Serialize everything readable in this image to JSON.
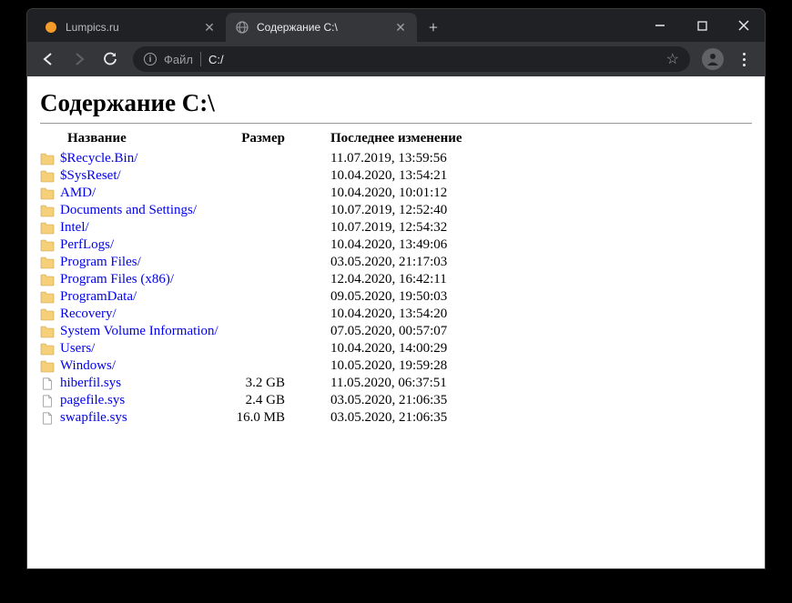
{
  "window": {
    "controls": {
      "minimize": "—",
      "maximize": "▢",
      "close": "✕"
    }
  },
  "tabs": [
    {
      "title": "Lumpics.ru",
      "active": false,
      "favicon": "orange-circle"
    },
    {
      "title": "Содержание C:\\",
      "active": true,
      "favicon": "globe"
    }
  ],
  "toolbar": {
    "address_label": "Файл",
    "address_path": "C:/",
    "newtab": "+"
  },
  "page": {
    "heading": "Содержание C:\\",
    "columns": {
      "name": "Название",
      "size": "Размер",
      "modified": "Последнее изменение"
    },
    "entries": [
      {
        "type": "dir",
        "name": "$Recycle.Bin/",
        "size": "",
        "modified": "11.07.2019, 13:59:56"
      },
      {
        "type": "dir",
        "name": "$SysReset/",
        "size": "",
        "modified": "10.04.2020, 13:54:21"
      },
      {
        "type": "dir",
        "name": "AMD/",
        "size": "",
        "modified": "10.04.2020, 10:01:12"
      },
      {
        "type": "dir",
        "name": "Documents and Settings/",
        "size": "",
        "modified": "10.07.2019, 12:52:40"
      },
      {
        "type": "dir",
        "name": "Intel/",
        "size": "",
        "modified": "10.07.2019, 12:54:32"
      },
      {
        "type": "dir",
        "name": "PerfLogs/",
        "size": "",
        "modified": "10.04.2020, 13:49:06"
      },
      {
        "type": "dir",
        "name": "Program Files/",
        "size": "",
        "modified": "03.05.2020, 21:17:03"
      },
      {
        "type": "dir",
        "name": "Program Files (x86)/",
        "size": "",
        "modified": "12.04.2020, 16:42:11"
      },
      {
        "type": "dir",
        "name": "ProgramData/",
        "size": "",
        "modified": "09.05.2020, 19:50:03"
      },
      {
        "type": "dir",
        "name": "Recovery/",
        "size": "",
        "modified": "10.04.2020, 13:54:20"
      },
      {
        "type": "dir",
        "name": "System Volume Information/",
        "size": "",
        "modified": "07.05.2020, 00:57:07"
      },
      {
        "type": "dir",
        "name": "Users/",
        "size": "",
        "modified": "10.04.2020, 14:00:29"
      },
      {
        "type": "dir",
        "name": "Windows/",
        "size": "",
        "modified": "10.05.2020, 19:59:28"
      },
      {
        "type": "file",
        "name": "hiberfil.sys",
        "size": "3.2 GB",
        "modified": "11.05.2020, 06:37:51"
      },
      {
        "type": "file",
        "name": "pagefile.sys",
        "size": "2.4 GB",
        "modified": "03.05.2020, 21:06:35"
      },
      {
        "type": "file",
        "name": "swapfile.sys",
        "size": "16.0 MB",
        "modified": "03.05.2020, 21:06:35"
      }
    ]
  }
}
